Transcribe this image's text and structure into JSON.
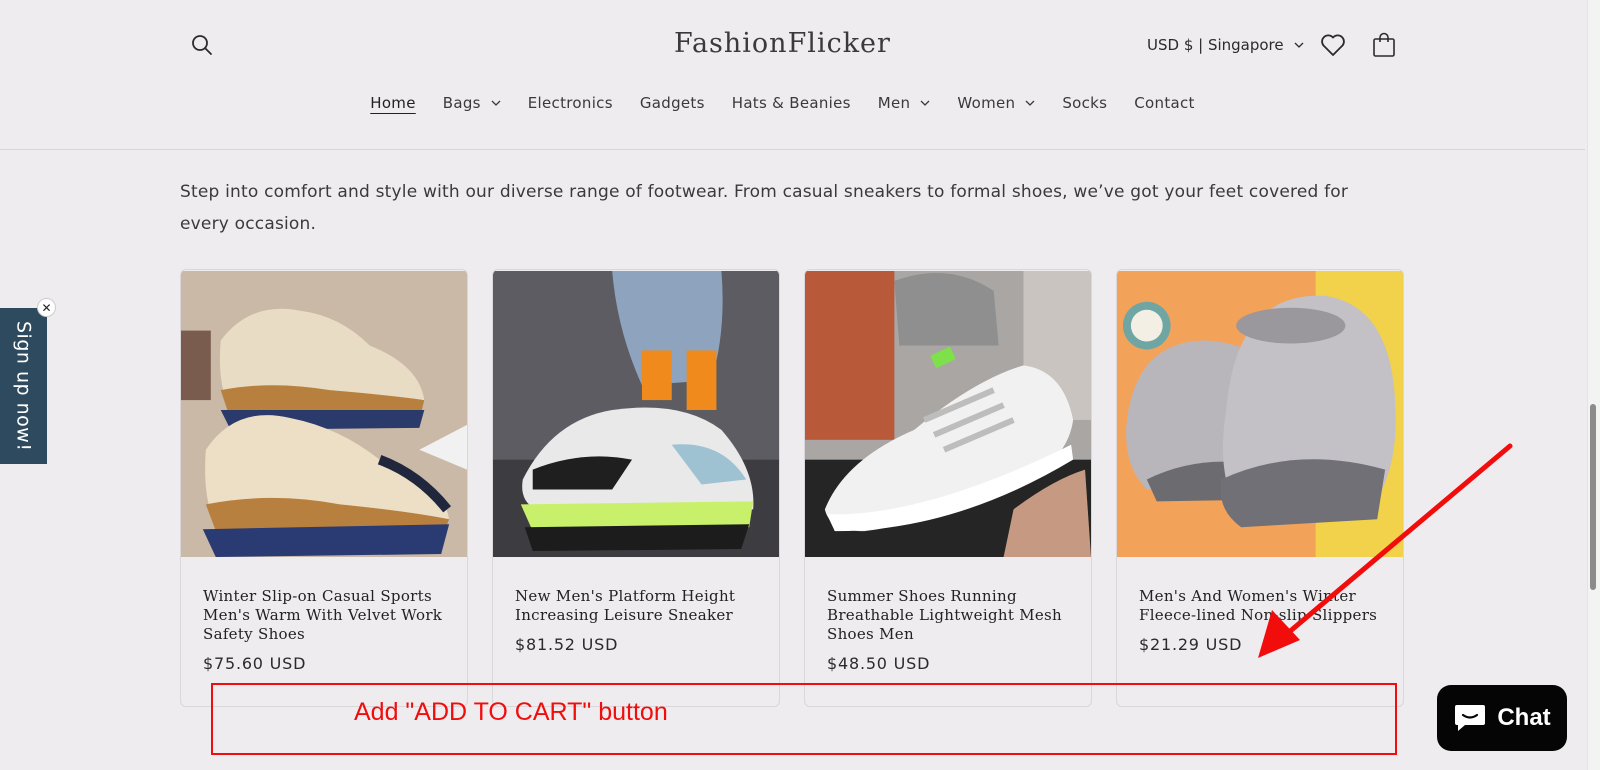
{
  "header": {
    "brand": "FashionFlicker",
    "currency": "USD $ | Singapore",
    "icons": {
      "search": "search-icon",
      "wishlist": "heart-icon",
      "cart": "bag-icon"
    }
  },
  "nav": {
    "items": [
      {
        "label": "Home",
        "active": true,
        "dropdown": false
      },
      {
        "label": "Bags",
        "active": false,
        "dropdown": true
      },
      {
        "label": "Electronics",
        "active": false,
        "dropdown": false
      },
      {
        "label": "Gadgets",
        "active": false,
        "dropdown": false
      },
      {
        "label": "Hats & Beanies",
        "active": false,
        "dropdown": false
      },
      {
        "label": "Men",
        "active": false,
        "dropdown": true
      },
      {
        "label": "Women",
        "active": false,
        "dropdown": true
      },
      {
        "label": "Socks",
        "active": false,
        "dropdown": false
      },
      {
        "label": "Contact",
        "active": false,
        "dropdown": false
      }
    ]
  },
  "collection": {
    "description": "Step into comfort and style with our diverse range of footwear. From casual sneakers to formal shoes, we’ve got your feet covered for every occasion."
  },
  "products": [
    {
      "title": "Winter Slip-on Casual Sports Men's Warm With Velvet Work Safety Shoes",
      "price": "$75.60 USD"
    },
    {
      "title": "New Men's Platform Height Increasing Leisure Sneaker",
      "price": "$81.52 USD"
    },
    {
      "title": "Summer Shoes Running Breathable Lightweight Mesh Shoes Men",
      "price": "$48.50 USD"
    },
    {
      "title": "Men's And Women's Winter Fleece-lined Non-slip Slippers",
      "price": "$21.29 USD"
    }
  ],
  "signup": {
    "label": "Sign up now!",
    "close": "✕"
  },
  "annotation": {
    "text": "Add \"ADD TO CART\" button",
    "color": "#f20d0d"
  },
  "chat": {
    "label": "Chat",
    "icon": "chat-bubble-icon"
  },
  "colors": {
    "background": "#eeecee",
    "signup_tab": "#2e4a5e",
    "chat_button": "#050505"
  }
}
